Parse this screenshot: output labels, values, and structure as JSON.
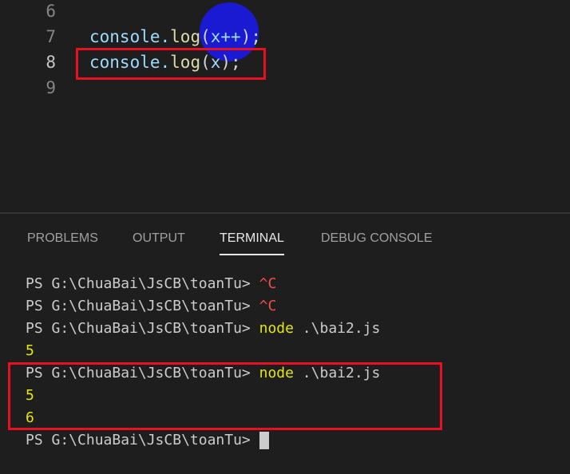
{
  "editor": {
    "lines": [
      {
        "num": "6",
        "fn": "",
        "arg": "",
        "pre": "",
        "post": ""
      },
      {
        "num": "7",
        "pre": "console.",
        "fn": "log",
        "open": "(",
        "arg": "x++",
        "close": ");"
      },
      {
        "num": "8",
        "pre": "console.",
        "fn": "log",
        "open": "(",
        "arg": "x",
        "close": ");"
      },
      {
        "num": "9"
      }
    ]
  },
  "panel": {
    "tabs": [
      "PROBLEMS",
      "OUTPUT",
      "TERMINAL",
      "DEBUG CONSOLE"
    ],
    "active_tab": "TERMINAL"
  },
  "terminal": {
    "prompt": "PS G:\\ChuaBai\\JsCB\\toanTu> ",
    "lines": [
      {
        "cmd": "^C",
        "type": "red"
      },
      {
        "cmd": "^C",
        "type": "red"
      },
      {
        "cmd": "node",
        "args": " .\\bai2.js"
      },
      {
        "output": "5"
      },
      {
        "cmd": "node",
        "args": " .\\bai2.js"
      },
      {
        "output": "5"
      },
      {
        "output": "6"
      }
    ]
  },
  "colors": {
    "highlight": "#e81123",
    "cursor": "#1a1ae6"
  }
}
